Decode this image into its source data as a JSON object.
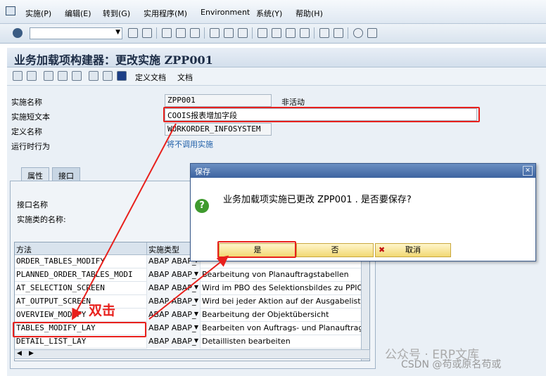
{
  "menu": {
    "items": [
      "实施(P)",
      "编辑(E)",
      "转到(G)",
      "实用程序(M)",
      "Environment",
      "系统(Y)",
      "帮助(H)"
    ]
  },
  "title": "业务加载项构建器：更改实施 ZPP001",
  "app_toolbar": {
    "doc_define": "定义文档",
    "doc": "文档"
  },
  "fields": {
    "impl_name_label": "实施名称",
    "impl_name_value": "ZPP001",
    "status": "非活动",
    "short_text_label": "实施短文本",
    "short_text_value": "COOIS报表增加字段",
    "def_name_label": "定义名称",
    "def_name_value": "WORKORDER_INFOSYSTEM",
    "runtime_label": "运行时行为",
    "runtime_value": "将不调用实施"
  },
  "tabs": [
    "属性",
    "接口"
  ],
  "interface": {
    "name_label": "接口名称",
    "class_label": "实施类的名称:"
  },
  "grid": {
    "headers": [
      "方法",
      "实施类型"
    ],
    "rows": [
      {
        "method": "ORDER_TABLES_MODIFY",
        "type": "ABAP ABAP_",
        "desc": ""
      },
      {
        "method": "PLANNED_ORDER_TABLES_MODI",
        "type": "ABAP ABAP_",
        "desc": "Bearbeitung von Planauftragstabellen"
      },
      {
        "method": "AT_SELECTION_SCREEN",
        "type": "ABAP ABAP_",
        "desc": "Wird im PBO des Selektionsbildes zu PPIO_EN"
      },
      {
        "method": "AT_OUTPUT_SCREEN",
        "type": "ABAP ABAP_",
        "desc": "Wird bei jeder Aktion auf der Ausgabeliste auf"
      },
      {
        "method": "OVERVIEW_MODIFY",
        "type": "ABAP ABAP_",
        "desc": "Bearbeitung der Objektübersicht"
      },
      {
        "method": "TABLES_MODIFY_LAY",
        "type": "ABAP ABAP_",
        "desc": "Bearbeiten von Auftrags- und Planauftragstabe"
      },
      {
        "method": "DETAIL_LIST_LAY",
        "type": "ABAP ABAP_",
        "desc": "Detaillisten bearbeiten"
      }
    ]
  },
  "dialog": {
    "title": "保存",
    "message": "业务加载项实施已更改 ZPP001 . 是否要保存?",
    "yes": "是",
    "no": "否",
    "cancel": "取消"
  },
  "annotation": "双击",
  "watermark": {
    "brand": "公众号 · ERP文库",
    "csdn": "CSDN @苟或原名苟或"
  },
  "colors": {
    "highlight": "#e8201c",
    "dialog_header": "#3d63a0"
  }
}
